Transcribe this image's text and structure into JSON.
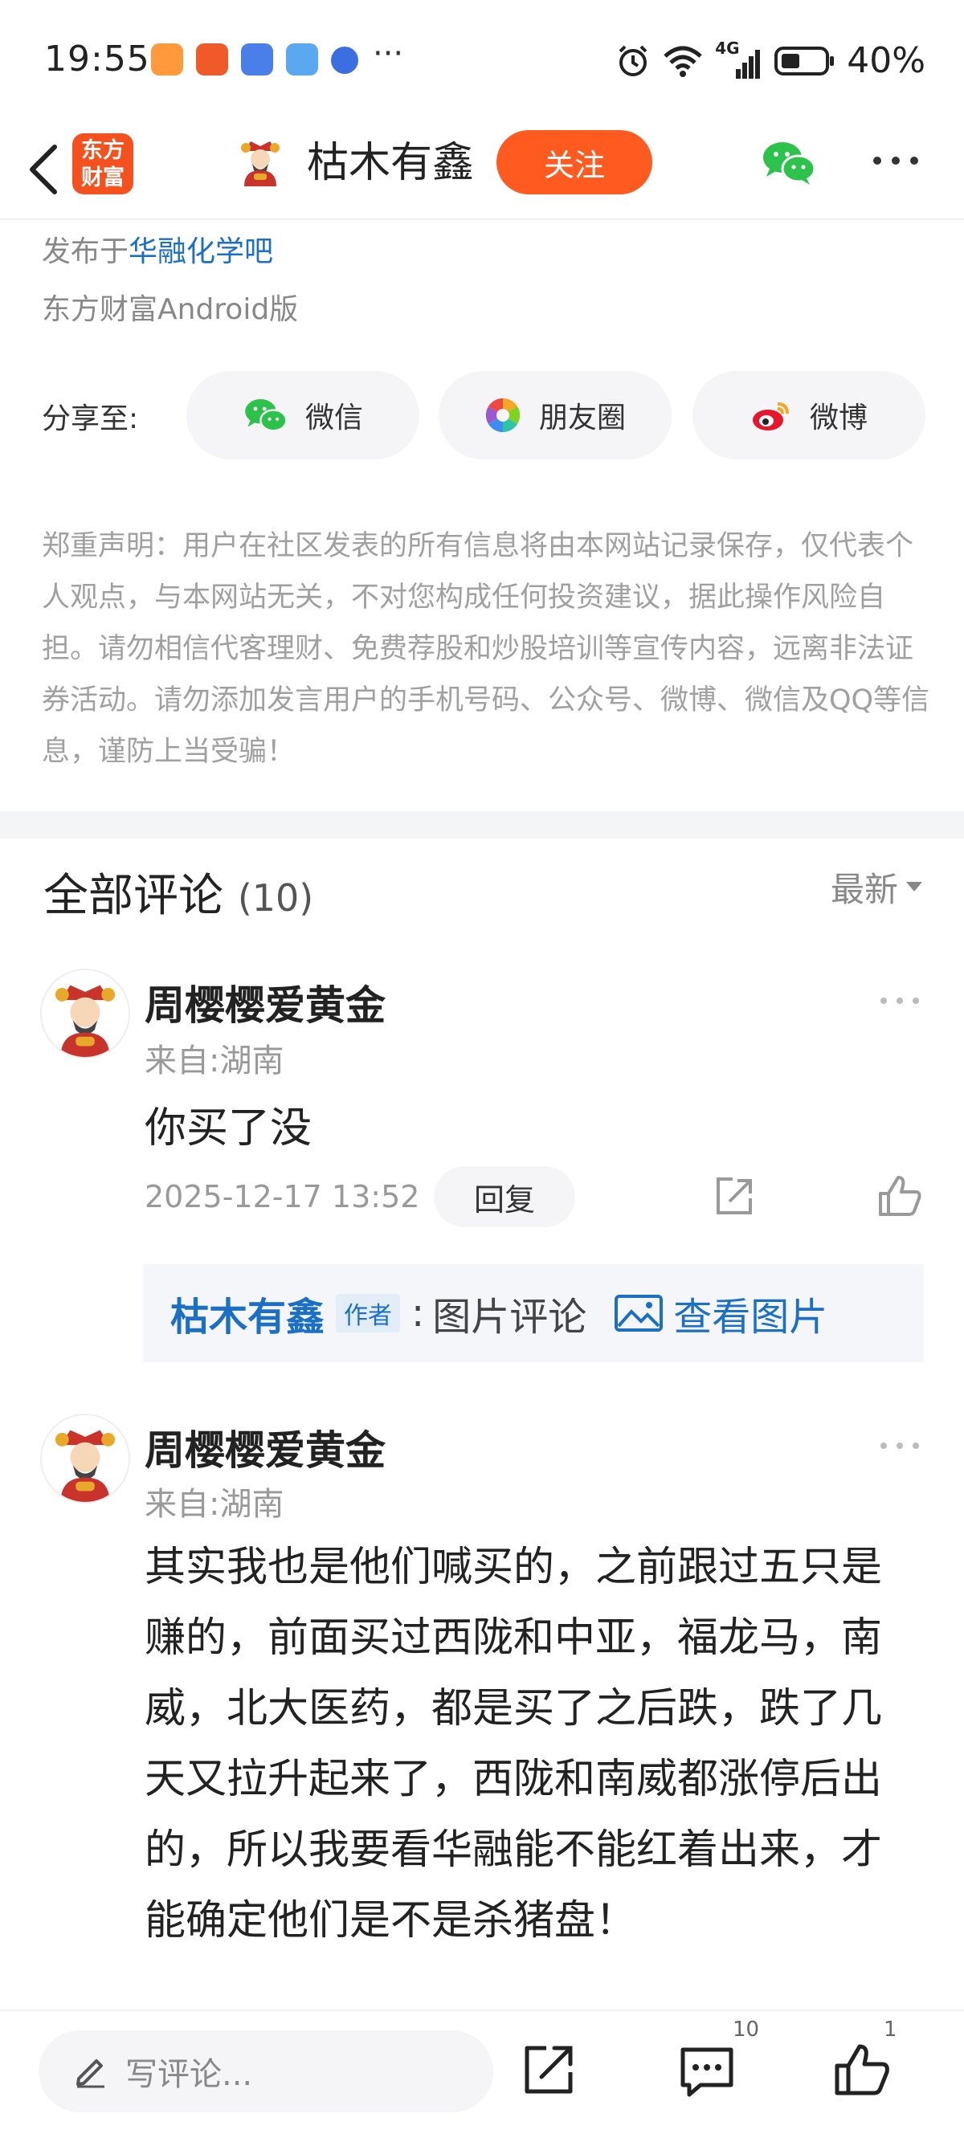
{
  "status_bar": {
    "time": "19:55",
    "dots": "···",
    "network": "4G",
    "battery": "40%"
  },
  "header": {
    "logo_line1": "东方",
    "logo_line2": "财富",
    "username": "枯木有鑫",
    "follow_label": "关注"
  },
  "post": {
    "published_prefix": "发布于",
    "bar_name": "华融化学吧",
    "client": "东方财富Android版"
  },
  "share": {
    "label": "分享至:",
    "wechat": "微信",
    "moments": "朋友圈",
    "weibo": "微博"
  },
  "disclaimer": "郑重声明：用户在社区发表的所有信息将由本网站记录保存，仅代表个人观点，与本网站无关，不对您构成任何投资建议，据此操作风险自担。请勿相信代客理财、免费荐股和炒股培训等宣传内容，远离非法证券活动。请勿添加发言用户的手机号码、公众号、微博、微信及QQ等信息，谨防上当受骗！",
  "comments": {
    "title": "全部评论",
    "count": "(10)",
    "sort_label": "最新",
    "items": [
      {
        "author": "周樱樱爱黄金",
        "from": "来自:湖南",
        "text": "你买了没",
        "date": "2025-12-17 13:52",
        "reply_label": "回复",
        "reply": {
          "name": "枯木有鑫",
          "tag": "作者",
          "sep": ":",
          "text": "图片评论",
          "view": "查看图片"
        }
      },
      {
        "author": "周樱樱爱黄金",
        "from": "来自:湖南",
        "text": "其实我也是他们喊买的，之前跟过五只是赚的，前面买过西陇和中亚，福龙马，南威，北大医药，都是买了之后跌，跌了几天又拉升起来了，西陇和南威都涨停后出的，所以我要看华融能不能红着出来，才能确定他们是不是杀猪盘！"
      }
    ]
  },
  "bottom_bar": {
    "placeholder": "写评论...",
    "comment_count": "10",
    "like_count": "1"
  },
  "colors": {
    "accent": "#ff5a1f",
    "link": "#1b6fc4"
  }
}
